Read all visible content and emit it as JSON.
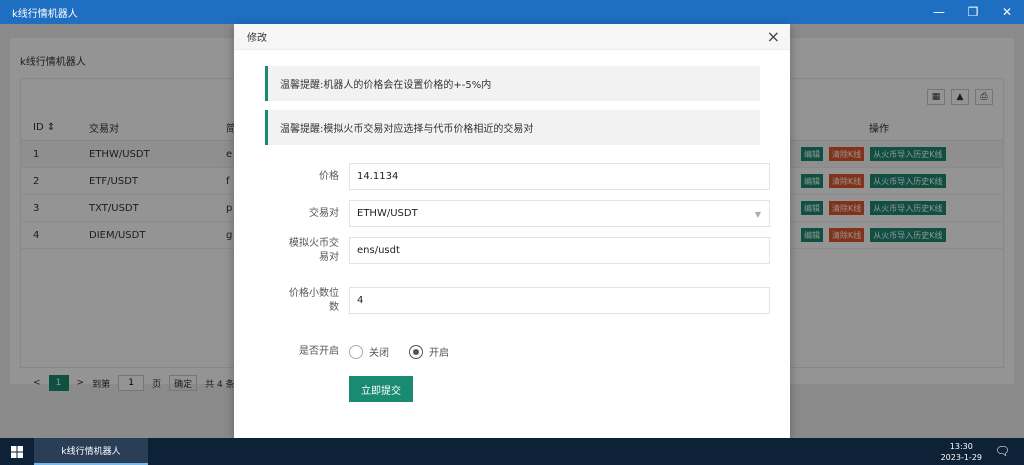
{
  "window": {
    "title": "k线行情机器人",
    "controls": [
      "—",
      "❐",
      "✕"
    ]
  },
  "app": {
    "heading": "k线行情机器人",
    "table": {
      "headers": {
        "id": "ID ⇕",
        "pair": "交易对",
        "desc": "简",
        "ops": "操作"
      },
      "rows": [
        {
          "id": "1",
          "pair": "ETHW/USDT",
          "desc": "e"
        },
        {
          "id": "2",
          "pair": "ETF/USDT",
          "desc": "f"
        },
        {
          "id": "3",
          "pair": "TXT/USDT",
          "desc": "p"
        },
        {
          "id": "4",
          "pair": "DIEM/USDT",
          "desc": "g"
        }
      ],
      "actions": {
        "edit": "编辑",
        "clear": "清除K线",
        "import": "从火币导入历史K线"
      }
    },
    "pager": {
      "prev": "<",
      "page": "1",
      "next": ">",
      "goto": "到第",
      "input": "1",
      "unit": "页",
      "confirm": "确定",
      "total": "共 4 条"
    }
  },
  "modal": {
    "title": "修改",
    "close": "×",
    "tips": [
      "温馨提醒:机器人的价格会在设置价格的+-5%内",
      "温馨提醒:模拟火币交易对应选择与代币价格相近的交易对"
    ],
    "fields": {
      "price_label": "价格",
      "price_value": "14.1134",
      "pair_label": "交易对",
      "pair_value": "ETHW/USDT",
      "huobi_label_1": "模拟火币交",
      "huobi_label_2": "易对",
      "huobi_value": "ens/usdt",
      "decimals_label_1": "价格小数位",
      "decimals_label_2": "数",
      "decimals_value": "4",
      "enabled_label": "是否开启",
      "off_label": "关闭",
      "on_label": "开启",
      "enabled": true
    },
    "submit": "立即提交"
  },
  "taskbar": {
    "app": "k线行情机器人",
    "time": "13:30",
    "date": "2023-1-29"
  }
}
